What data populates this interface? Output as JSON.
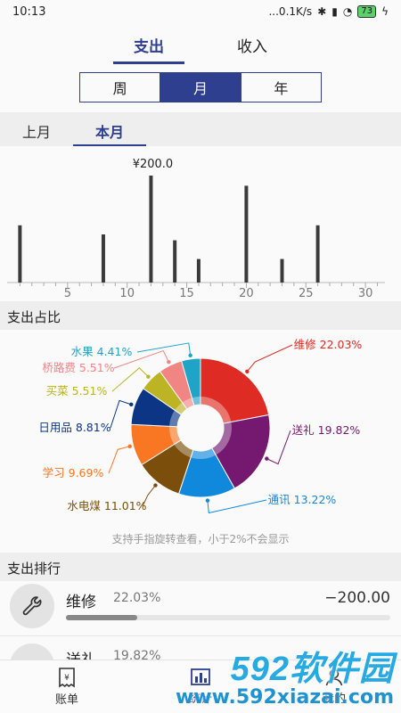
{
  "status": {
    "time": "10:13",
    "network": "...0.1K/s",
    "battery": "73"
  },
  "top_tabs": [
    {
      "label": "支出",
      "active": true
    },
    {
      "label": "收入",
      "active": false
    }
  ],
  "period": {
    "options": [
      "周",
      "月",
      "年"
    ],
    "selected": "月"
  },
  "month_tabs": [
    {
      "label": "上月",
      "active": false
    },
    {
      "label": "本月",
      "active": true
    }
  ],
  "chart_data": [
    {
      "type": "bar",
      "title": "",
      "xlabel": "",
      "ylabel": "",
      "max_label": "¥200.0",
      "xlim": [
        0,
        31
      ],
      "xticks": [
        5,
        10,
        15,
        20,
        25,
        30
      ],
      "ylim": [
        0,
        200
      ],
      "series": [
        {
          "x": [
            1,
            8,
            12,
            14,
            16,
            20,
            23,
            26
          ],
          "values": [
            107,
            90,
            200,
            79,
            44,
            181,
            44,
            107
          ]
        }
      ]
    },
    {
      "type": "pie",
      "title": "",
      "donut": true,
      "slices": [
        {
          "label": "维修",
          "pct": 22.03,
          "text": "维修 22.03%",
          "color": "#de2b23"
        },
        {
          "label": "送礼",
          "pct": 19.82,
          "text": "送礼 19.82%",
          "color": "#74196f"
        },
        {
          "label": "通讯",
          "pct": 13.22,
          "text": "通讯 13.22%",
          "color": "#1088dc"
        },
        {
          "label": "水电煤",
          "pct": 11.01,
          "text": "水电煤 11.01%",
          "color": "#7b4e0c"
        },
        {
          "label": "学习",
          "pct": 9.69,
          "text": "学习 9.69%",
          "color": "#f97622"
        },
        {
          "label": "日用品",
          "pct": 8.81,
          "text": "日用品 8.81%",
          "color": "#0c3585"
        },
        {
          "label": "买菜",
          "pct": 5.51,
          "text": "买菜 5.51%",
          "color": "#bcb424"
        },
        {
          "label": "桥路费",
          "pct": 5.51,
          "text": "桥路费 5.51%",
          "color": "#f08583"
        },
        {
          "label": "水果",
          "pct": 4.41,
          "text": "水果 4.41%",
          "color": "#1ea4c7"
        }
      ]
    }
  ],
  "section_ratio": "支出占比",
  "pie_note": "支持手指旋转查看，小于2%不会显示",
  "section_rank": "支出排行",
  "ranking": [
    {
      "name": "维修",
      "pct": "22.03%",
      "amount": "−200.00",
      "fraction": 0.22
    },
    {
      "name": "送礼",
      "pct": "19.82%",
      "amount": "",
      "fraction": 0.198
    }
  ],
  "nav": [
    {
      "label": "账单",
      "icon": "receipt-icon",
      "active": false
    },
    {
      "label": "统计",
      "icon": "chart-icon",
      "active": true
    },
    {
      "label": "我的",
      "icon": "user-icon",
      "active": false
    }
  ],
  "watermark": {
    "main": "592软件园",
    "sub": "www.592xiazai.com"
  },
  "colors": {
    "accent": "#2e3f8f"
  }
}
